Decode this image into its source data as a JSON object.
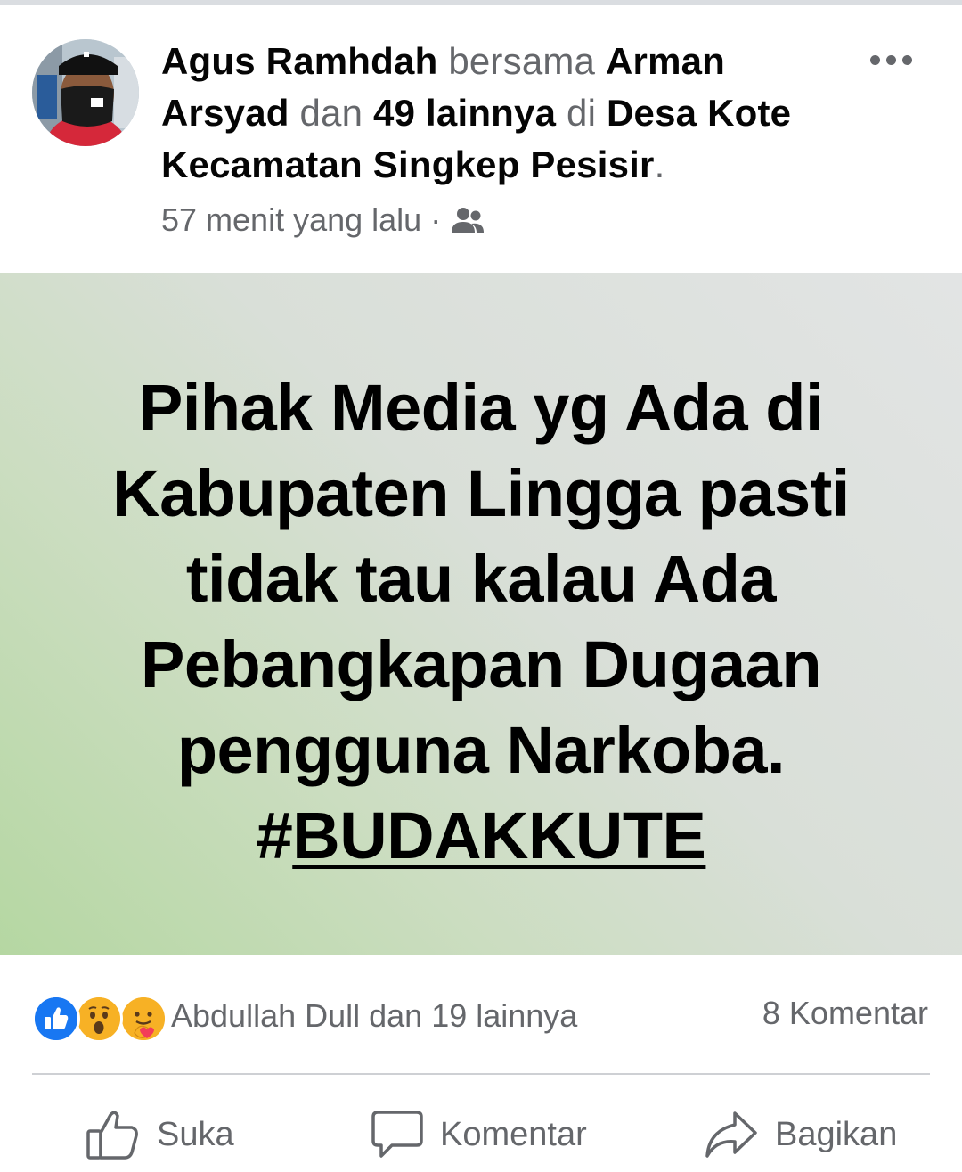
{
  "post": {
    "author": "Agus Ramhdah",
    "with_word": "bersama",
    "tagged_user": "Arman Arsyad",
    "and_word": "dan",
    "others": "49 lainnya",
    "at_word": "di",
    "location": "Desa Kote Kecamatan Singkep Pesisir",
    "period": ".",
    "timestamp": "57 menit yang lalu",
    "separator": "·",
    "audience_icon": "friends-icon",
    "body_lines": [
      "Pihak Media yg Ada di",
      "Kabupaten Lingga pasti",
      "tidak tau kalau Ada",
      "Pebangkapan Dugaan",
      "pengguna Narkoba."
    ],
    "hash_symbol": "#",
    "hashtag": "BUDAKKUTE"
  },
  "reactions": {
    "icons": [
      "like-icon",
      "wow-icon",
      "care-icon"
    ],
    "text": "Abdullah Dull dan 19 lainnya",
    "comments": "8 Komentar"
  },
  "actions": {
    "like": "Suka",
    "comment": "Komentar",
    "share": "Bagikan"
  },
  "colors": {
    "text_primary": "#050505",
    "text_secondary": "#65676b",
    "like_blue": "#1877f2",
    "wow_yellow": "#f7b125",
    "bg_gradient_start": "#b5d7a2",
    "bg_gradient_end": "#e2e4e4"
  }
}
